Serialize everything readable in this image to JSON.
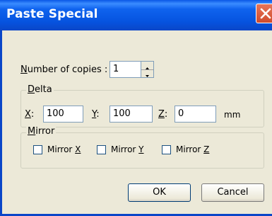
{
  "window": {
    "title": "Paste Special"
  },
  "copies": {
    "label": "Number of copies :",
    "mnemonic": "N",
    "rest": "umber of copies :",
    "value": "1"
  },
  "delta": {
    "legend": "Delta",
    "legend_mnemonic": "D",
    "legend_rest": "elta",
    "x_label_key": "X",
    "x_label_rest": ":",
    "x_value": "100",
    "y_label_key": "Y",
    "y_label_rest": ":",
    "y_value": "100",
    "z_label_key": "Z",
    "z_label_rest": ":",
    "z_value": "0",
    "unit": "mm"
  },
  "mirror": {
    "legend": "Mirror",
    "legend_mnemonic": "M",
    "legend_rest": "irror",
    "items": [
      {
        "prefix": "Mirror ",
        "key": "X",
        "checked": false
      },
      {
        "prefix": "Mirror ",
        "key": "Y",
        "checked": false
      },
      {
        "prefix": "Mirror ",
        "key": "Z",
        "checked": false
      }
    ]
  },
  "buttons": {
    "ok": "OK",
    "cancel": "Cancel"
  },
  "icons": {
    "close": "close-icon",
    "spin_up": "arrow-up-icon",
    "spin_down": "arrow-down-icon"
  },
  "colors": {
    "titlebar": "#0a5ae6",
    "close_button": "#d9532f",
    "dialog_bg": "#ece9d8"
  }
}
